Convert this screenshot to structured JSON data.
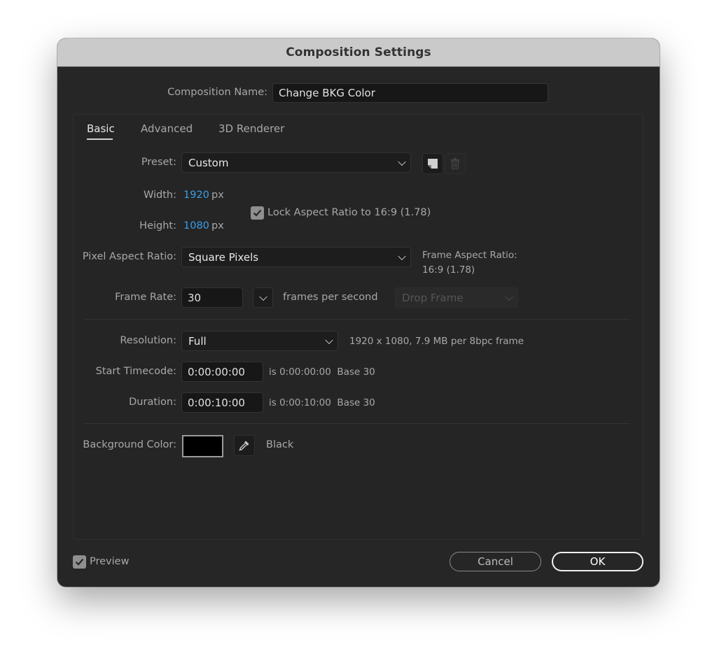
{
  "window": {
    "title": "Composition Settings"
  },
  "composition_name": {
    "label": "Composition Name:",
    "value": "Change BKG Color"
  },
  "tabs": [
    {
      "label": "Basic",
      "active": true
    },
    {
      "label": "Advanced",
      "active": false
    },
    {
      "label": "3D Renderer",
      "active": false
    }
  ],
  "preset": {
    "label": "Preset:",
    "value": "Custom",
    "save_icon": "save-preset-icon",
    "delete_icon": "trash-icon"
  },
  "width": {
    "label": "Width:",
    "value": "1920",
    "unit": "px"
  },
  "height": {
    "label": "Height:",
    "value": "1080",
    "unit": "px"
  },
  "lock_aspect": {
    "label": "Lock Aspect Ratio to 16:9 (1.78)",
    "checked": true
  },
  "pixel_aspect_ratio": {
    "label": "Pixel Aspect Ratio:",
    "value": "Square Pixels"
  },
  "frame_aspect_ratio": {
    "label": "Frame Aspect Ratio:",
    "value": "16:9 (1.78)"
  },
  "frame_rate": {
    "label": "Frame Rate:",
    "value": "30",
    "unit": "frames per second",
    "drop_frame": "Drop Frame"
  },
  "resolution": {
    "label": "Resolution:",
    "value": "Full",
    "info": "1920 x 1080, 7.9 MB per 8bpc frame"
  },
  "start_timecode": {
    "label": "Start Timecode:",
    "value": "0:00:00:00",
    "info": "is 0:00:00:00  Base 30"
  },
  "duration": {
    "label": "Duration:",
    "value": "0:00:10:00",
    "info": "is 0:00:10:00  Base 30"
  },
  "background_color": {
    "label": "Background Color:",
    "color": "#000000",
    "name": "Black",
    "eyedropper_icon": "eyedropper-icon"
  },
  "footer": {
    "preview_label": "Preview",
    "preview_checked": true,
    "cancel_label": "Cancel",
    "ok_label": "OK"
  },
  "colors": {
    "dialog_bg": "#262626",
    "titlebar_bg": "#c9cac9",
    "accent_blue": "#3b9ee8"
  }
}
